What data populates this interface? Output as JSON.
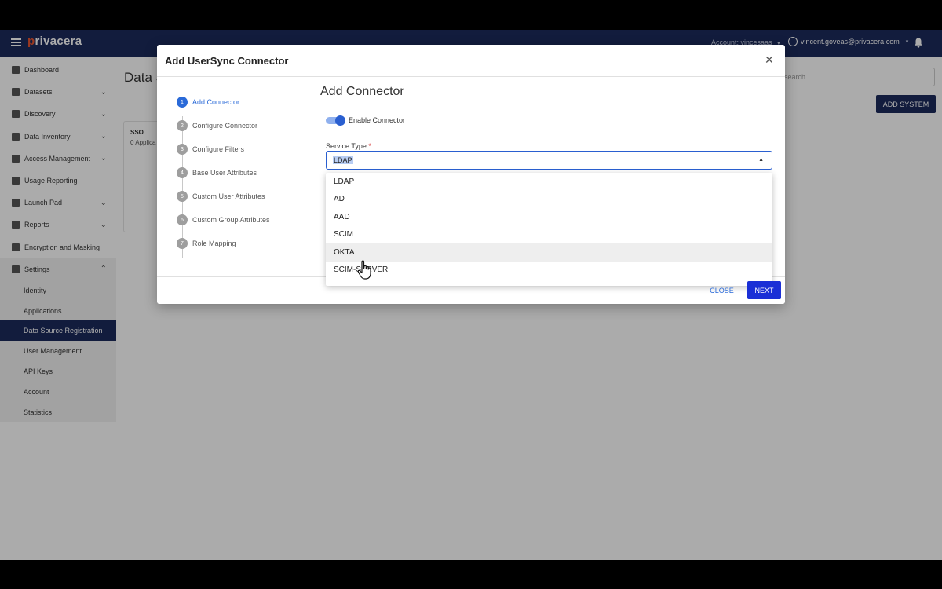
{
  "app": {
    "logo": "privacera",
    "account": "Account: vincesaas",
    "user_email": "vincent.goveas@privacera.com"
  },
  "sidebar": {
    "items": [
      {
        "label": "Dashboard",
        "icon": "dashboard-icon",
        "chevron": false
      },
      {
        "label": "Datasets",
        "icon": "datasets-icon",
        "chevron": true
      },
      {
        "label": "Discovery",
        "icon": "discovery-icon",
        "chevron": true
      },
      {
        "label": "Data Inventory",
        "icon": "inventory-icon",
        "chevron": true
      },
      {
        "label": "Access Management",
        "icon": "access-icon",
        "chevron": true
      },
      {
        "label": "Usage Reporting",
        "icon": "reporting-icon",
        "chevron": false
      },
      {
        "label": "Launch Pad",
        "icon": "launchpad-icon",
        "chevron": true
      },
      {
        "label": "Reports",
        "icon": "reports-icon",
        "chevron": true
      },
      {
        "label": "Encryption and Masking",
        "icon": "encryption-icon",
        "chevron": false
      }
    ],
    "settings": {
      "label": "Settings",
      "sub_items": [
        "Identity",
        "Applications",
        "Data Source Registration",
        "User Management",
        "API Keys",
        "Account",
        "Statistics"
      ],
      "active": "Data Source Registration"
    }
  },
  "main": {
    "title": "Data S",
    "search_placeholder": "search",
    "add_button": "ADD SYSTEM",
    "card": {
      "title": "SSO",
      "subtitle": "0 Applica"
    }
  },
  "dialog": {
    "title": "Add UserSync Connector",
    "steps": [
      {
        "num": "1",
        "label": "Add Connector",
        "active": true
      },
      {
        "num": "2",
        "label": "Configure Connector",
        "active": false
      },
      {
        "num": "3",
        "label": "Configure Filters",
        "active": false
      },
      {
        "num": "4",
        "label": "Base User Attributes",
        "active": false
      },
      {
        "num": "5",
        "label": "Custom User Attributes",
        "active": false
      },
      {
        "num": "6",
        "label": "Custom Group Attributes",
        "active": false
      },
      {
        "num": "7",
        "label": "Role Mapping",
        "active": false
      }
    ],
    "section_title": "Add Connector",
    "toggle_label": "Enable Connector",
    "toggle_on": true,
    "field_label": "Service Type",
    "required_mark": "*",
    "selected_value": "LDAP",
    "options": [
      "LDAP",
      "AD",
      "AAD",
      "SCIM",
      "OKTA",
      "SCIM-SERVER"
    ],
    "hovered_option": "OKTA",
    "close_label": "CLOSE",
    "next_label": "NEXT"
  }
}
